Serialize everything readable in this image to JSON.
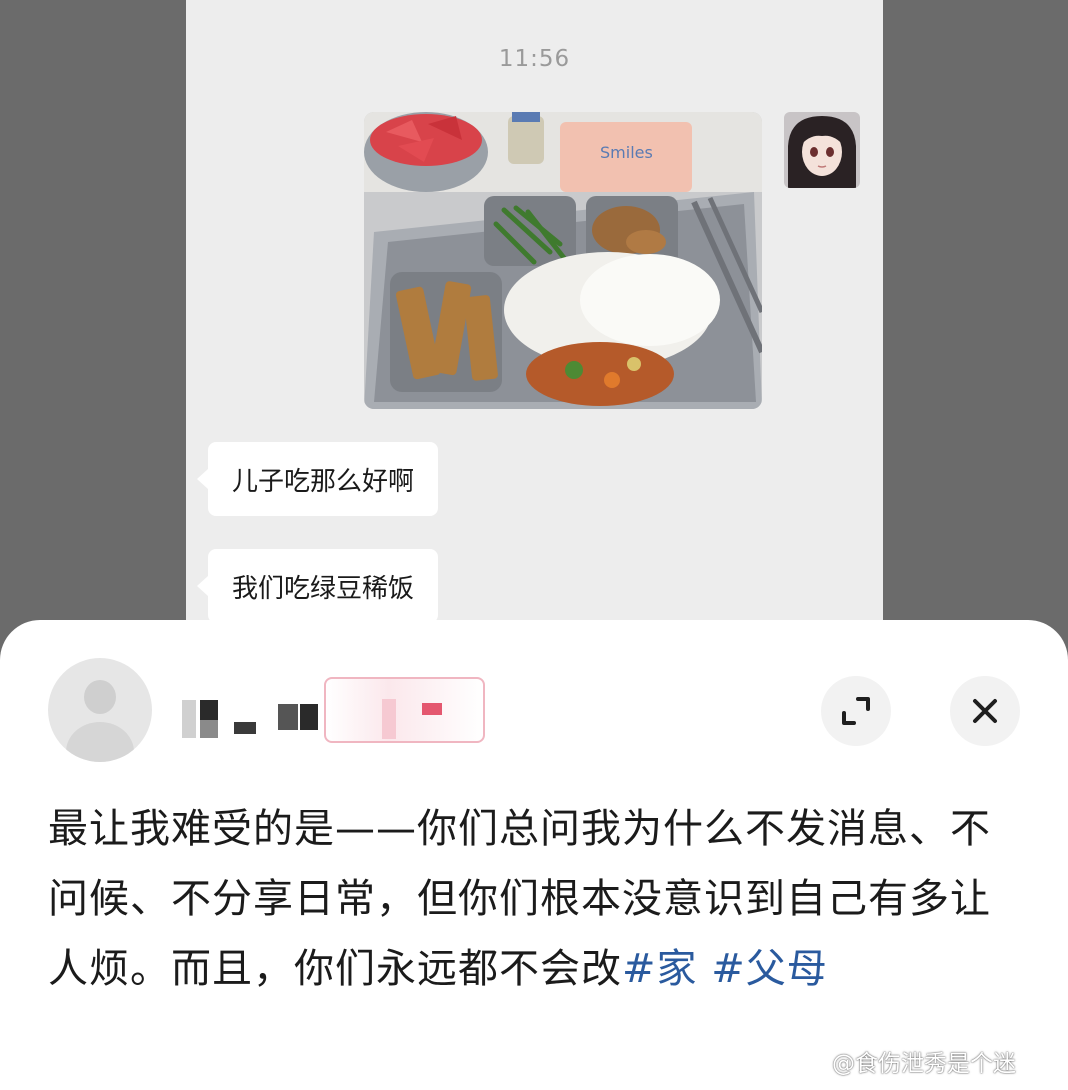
{
  "chat": {
    "timestamp": "11:56",
    "messages": [
      {
        "text": "儿子吃那么好啊"
      },
      {
        "text": "我们吃绿豆稀饭"
      }
    ],
    "photo_icon": "food-tray-photo",
    "avatar_icon": "anime-girl-avatar"
  },
  "sheet": {
    "avatar_icon": "user-avatar-icon",
    "expand_icon": "expand-icon",
    "close_icon": "close-icon",
    "post_text_main": "最让我难受的是——你们总问我为什么不发消息、不问候、不分享日常，但你们根本没意识到自己有多让人烦。而且，你们永远都不会改",
    "hashtags": [
      "#家",
      "#父母"
    ]
  },
  "watermark": {
    "text": "@食伤泄秀是个迷",
    "icon": "weibo-logo-icon"
  },
  "colors": {
    "hashtag": "#2a5a9e",
    "chat_bg": "#ededed",
    "backdrop": "#6b6b6b"
  }
}
